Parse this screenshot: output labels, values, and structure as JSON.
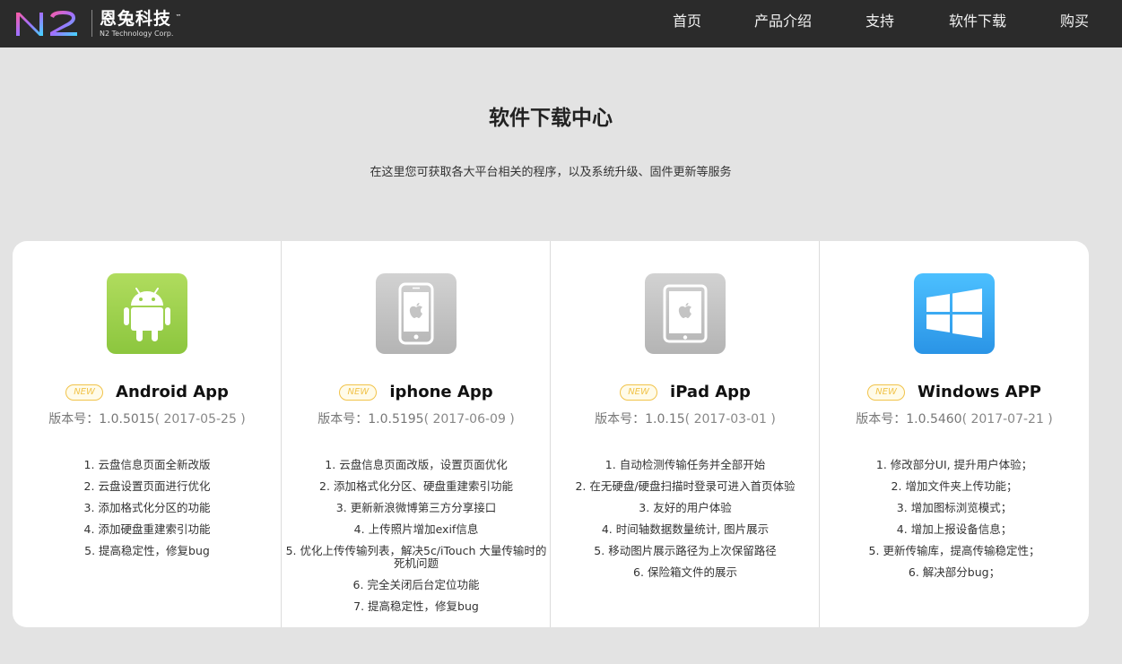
{
  "header": {
    "logo_cn": "恩兔科技",
    "logo_tm": "™",
    "logo_en": "N2 Technology Corp.",
    "logo_icon": "n2-logo-icon",
    "nav": [
      "首页",
      "产品介绍",
      "支持",
      "软件下载",
      "购买"
    ]
  },
  "main": {
    "title": "软件下载中心",
    "subtitle": "在这里您可获取各大平台相关的程序，以及系统升级、固件更新等服务"
  },
  "apps": [
    {
      "badge": "NEW",
      "name": "Android App",
      "version_label": "版本号：1.0.5015",
      "date": "( 2017-05-25 )",
      "icon": "android-icon",
      "notes": [
        "1. 云盘信息页面全新改版",
        "2. 云盘设置页面进行优化",
        "3. 添加格式化分区的功能",
        "4. 添加硬盘重建索引功能",
        "5. 提高稳定性，修复bug"
      ]
    },
    {
      "badge": "NEW",
      "name": "iphone App",
      "version_label": "版本号：1.0.5195",
      "date": "( 2017-06-09 )",
      "icon": "iphone-icon",
      "notes": [
        "1. 云盘信息页面改版，设置页面优化",
        "2. 添加格式化分区、硬盘重建索引功能",
        "3. 更新新浪微博第三方分享接口",
        "4. 上传照片增加exif信息",
        "5. 优化上传传输列表，解决5c/iTouch 大量传输时的死机问题",
        "6. 完全关闭后台定位功能",
        "7. 提高稳定性，修复bug"
      ]
    },
    {
      "badge": "NEW",
      "name": "iPad App",
      "version_label": "版本号：1.0.15",
      "date": "( 2017-03-01 )",
      "icon": "ipad-icon",
      "notes": [
        "1. 自动检测传输任务并全部开始",
        "2. 在无硬盘/硬盘扫描时登录可进入首页体验",
        "3. 友好的用户体验",
        "4. 时间轴数据数量统计, 图片展示",
        "5. 移动图片展示路径为上次保留路径",
        "6. 保险箱文件的展示"
      ]
    },
    {
      "badge": "NEW",
      "name": "Windows APP",
      "version_label": "版本号：1.0.5460",
      "date": "( 2017-07-21 )",
      "icon": "windows-icon",
      "notes": [
        "1. 修改部分UI, 提升用户体验；",
        "2. 增加文件夹上传功能；",
        "3. 增加图标浏览模式；",
        "4. 增加上报设备信息；",
        "5. 更新传输库，提高传输稳定性；",
        "6. 解决部分bug；"
      ]
    }
  ],
  "colors": {
    "topbar": "#2b2b2b",
    "background": "#e3e3e3",
    "android_green": "#9bd04a",
    "apple_gray": "#c4c4c4",
    "windows_blue": "#36a8f0",
    "badge_yellow": "#f1c34a"
  }
}
